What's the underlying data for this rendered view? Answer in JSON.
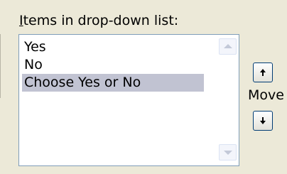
{
  "dialog": {
    "items_label_accel": "I",
    "items_label_rest": "tems in drop-down list:",
    "move_label": "Move"
  },
  "listbox": {
    "items": [
      {
        "label": "Yes",
        "selected": false
      },
      {
        "label": "No",
        "selected": false
      },
      {
        "label": "Choose Yes or No",
        "selected": true
      }
    ],
    "selection_color": "#c1c3d2"
  },
  "icons": {
    "scroll_up": "scroll-up-arrow",
    "scroll_down": "scroll-down-arrow",
    "move_up": "up-arrow",
    "move_down": "down-arrow"
  }
}
